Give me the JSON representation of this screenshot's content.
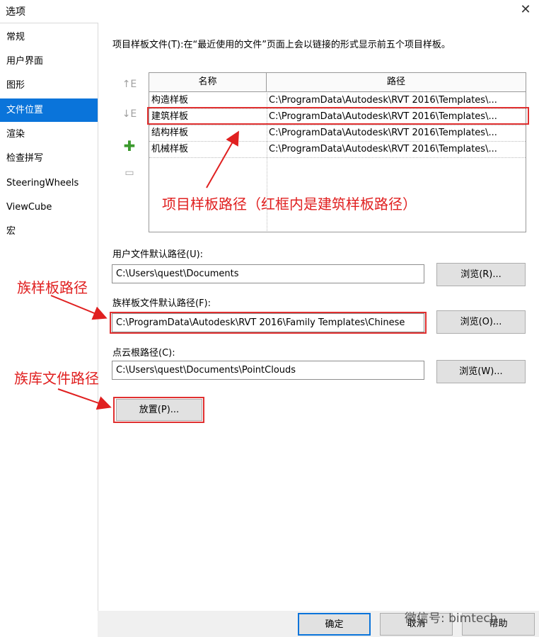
{
  "window": {
    "title": "选项",
    "close_glyph": "✕"
  },
  "sidebar": {
    "items": [
      {
        "label": "常规"
      },
      {
        "label": "用户界面"
      },
      {
        "label": "图形"
      },
      {
        "label": "文件位置",
        "active": true
      },
      {
        "label": "渲染"
      },
      {
        "label": "检查拼写"
      },
      {
        "label": "SteeringWheels"
      },
      {
        "label": "ViewCube"
      },
      {
        "label": "宏"
      }
    ]
  },
  "main": {
    "description": "项目样板文件(T):在“最近使用的文件”页面上会以链接的形式显示前五个项目样板。",
    "tools": {
      "move_up": "↑E",
      "move_down": "↓E",
      "add": "✚",
      "remove": "▭"
    },
    "templates_table": {
      "headers": [
        "名称",
        "路径"
      ],
      "rows": [
        {
          "name": "构造样板",
          "path": "C:\\ProgramData\\Autodesk\\RVT 2016\\Templates\\..."
        },
        {
          "name": "建筑样板",
          "path": "C:\\ProgramData\\Autodesk\\RVT 2016\\Templates\\..."
        },
        {
          "name": "结构样板",
          "path": "C:\\ProgramData\\Autodesk\\RVT 2016\\Templates\\..."
        },
        {
          "name": "机械样板",
          "path": "C:\\ProgramData\\Autodesk\\RVT 2016\\Templates\\..."
        }
      ]
    },
    "user_path": {
      "label": "用户文件默认路径(U):",
      "value": "C:\\Users\\quest\\Documents",
      "browse": "浏览(R)..."
    },
    "family_path": {
      "label": "族样板文件默认路径(F):",
      "value": "C:\\ProgramData\\Autodesk\\RVT 2016\\Family Templates\\Chinese",
      "browse": "浏览(O)..."
    },
    "pointcloud_path": {
      "label": "点云根路径(C):",
      "value": "C:\\Users\\quest\\Documents\\PointClouds",
      "browse": "浏览(W)..."
    },
    "places_button": "放置(P)..."
  },
  "annotations": {
    "project_template": "项目样板路径（红框内是建筑样板路径）",
    "family_template": "族样板路径",
    "family_library": "族库文件路径",
    "color": "#e02020"
  },
  "footer": {
    "ok": "确定",
    "cancel": "取消",
    "help": "帮助",
    "watermark": "微信号: bimtech"
  }
}
